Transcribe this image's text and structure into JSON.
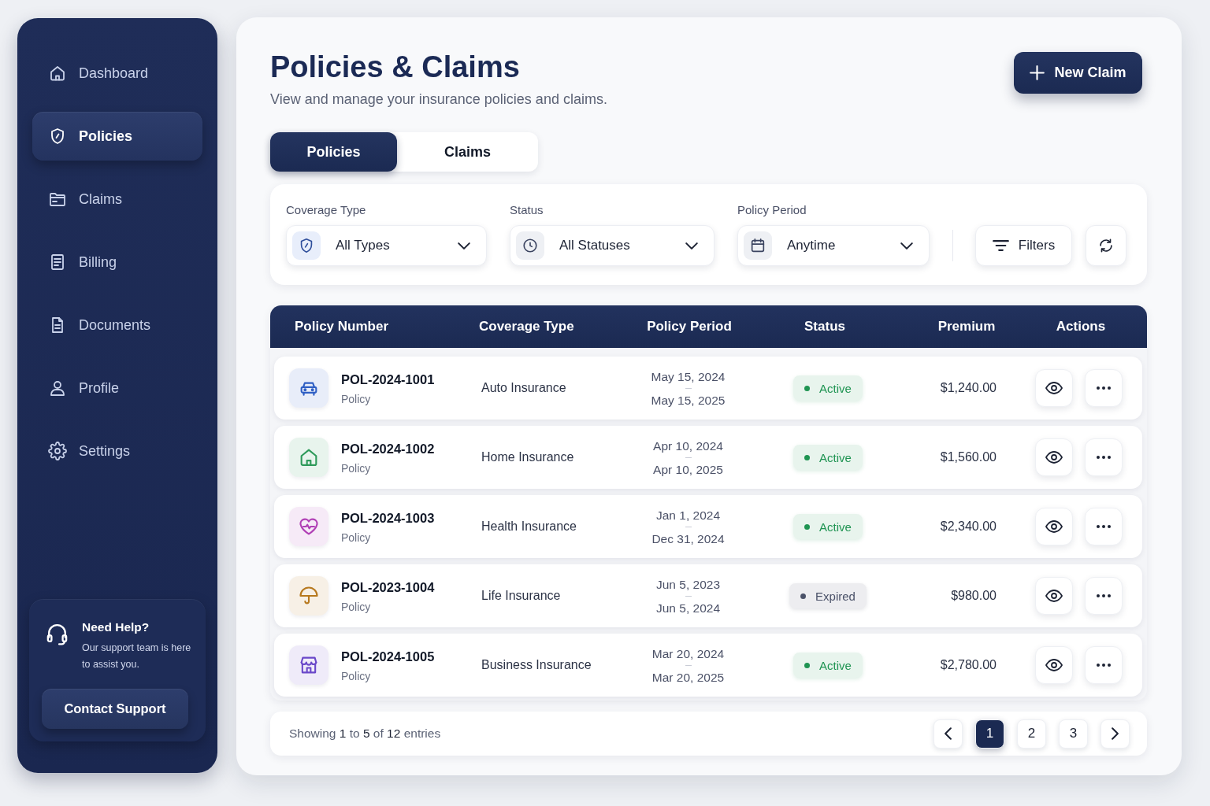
{
  "sidebar": {
    "items": [
      {
        "label": "Dashboard",
        "kind": "home",
        "selected": false
      },
      {
        "label": "Policies",
        "kind": "shield",
        "selected": true
      },
      {
        "label": "Claims",
        "kind": "folder",
        "selected": false
      },
      {
        "label": "Billing",
        "kind": "receipt",
        "selected": false
      },
      {
        "label": "Documents",
        "kind": "document",
        "selected": false
      },
      {
        "label": "Profile",
        "kind": "person",
        "selected": false
      },
      {
        "label": "Settings",
        "kind": "gear",
        "selected": false
      }
    ],
    "help": {
      "title": "Need Help?",
      "text": "Our support team is here to assist you.",
      "button": "Contact Support"
    }
  },
  "header": {
    "title": "Policies & Claims",
    "subtitle": "View and manage your insurance policies and claims.",
    "button": "New Claim"
  },
  "tabs": [
    {
      "label": "Policies",
      "selected": true
    },
    {
      "label": "Claims",
      "selected": false
    }
  ],
  "filters": {
    "fields": [
      {
        "label": "Coverage Type",
        "value": "All Types",
        "kind": "shield"
      },
      {
        "label": "Status",
        "value": "All Statuses",
        "kind": "clock"
      },
      {
        "label": "Policy Period",
        "value": "Anytime",
        "kind": "calendar"
      }
    ],
    "button": "Filters"
  },
  "table": {
    "columns": [
      "Policy Number",
      "Coverage Type",
      "Policy Period",
      "Status",
      "Premium",
      "Actions"
    ],
    "rows": [
      {
        "kind": "car",
        "color": "#2f5fc4",
        "number": "POL-2024-1001",
        "label": "Policy",
        "coverage": "Auto Insurance",
        "period_start": "May 15, 2024",
        "period_end": "May 15, 2025",
        "status": {
          "text": "Active",
          "color": "#1f9452"
        },
        "premium": "$1,240.00"
      },
      {
        "kind": "house",
        "color": "#2e9a5a",
        "number": "POL-2024-1002",
        "label": "Policy",
        "coverage": "Home Insurance",
        "period_start": "Apr 10, 2024",
        "period_end": "Apr 10, 2025",
        "status": {
          "text": "Active",
          "color": "#1f9452"
        },
        "premium": "$1,560.00"
      },
      {
        "kind": "heart",
        "color": "#b03fb5",
        "number": "POL-2024-1003",
        "label": "Policy",
        "coverage": "Health Insurance",
        "period_start": "Jan 1, 2024",
        "period_end": "Dec 31, 2024",
        "status": {
          "text": "Active",
          "color": "#1f9452"
        },
        "premium": "$2,340.00"
      },
      {
        "kind": "umbrella",
        "color": "#b7791f",
        "number": "POL-2023-1004",
        "label": "Policy",
        "coverage": "Life Insurance",
        "period_start": "Jun 5, 2023",
        "period_end": "Jun 5, 2024",
        "status": {
          "text": "Expired",
          "color": "#4a5168"
        },
        "premium": "$980.00"
      },
      {
        "kind": "store",
        "color": "#6a48c9",
        "number": "POL-2024-1005",
        "label": "Policy",
        "coverage": "Business Insurance",
        "period_start": "Mar 20, 2024",
        "period_end": "Mar 20, 2025",
        "status": {
          "text": "Active",
          "color": "#1f9452"
        },
        "premium": "$2,780.00"
      }
    ]
  },
  "footer": {
    "summary": "Showing **1** to **5** of **12** entries",
    "pages": [
      {
        "label": "1",
        "selected": true
      },
      {
        "label": "2",
        "selected": false
      },
      {
        "label": "3",
        "selected": false
      }
    ]
  }
}
